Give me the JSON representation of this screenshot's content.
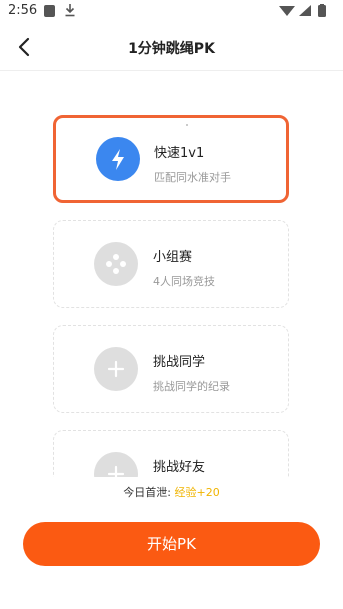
{
  "status_bar": {
    "time": "2:56",
    "icons": [
      "app-icon",
      "download-icon",
      "wifi-icon",
      "signal-icon",
      "battery-icon"
    ]
  },
  "header": {
    "back_icon": "back-arrow-icon",
    "title": "1分钟跳绳PK"
  },
  "modes": [
    {
      "title": "快速1v1",
      "subtitle": "匹配同水准对手",
      "icon": "lightning-icon",
      "selected": true,
      "icon_color": "#3b87ef"
    },
    {
      "title": "小组赛",
      "subtitle": "4人同场竞技",
      "icon": "gamepad-icon",
      "selected": false
    },
    {
      "title": "挑战同学",
      "subtitle": "挑战同学的纪录",
      "icon": "plus-icon",
      "selected": false
    },
    {
      "title": "挑战好友",
      "subtitle": "",
      "icon": "plus-icon",
      "selected": false
    }
  ],
  "footer": {
    "today_label": "今日首泄:",
    "today_reward": "经验+20",
    "start_button": "开始PK"
  },
  "colors": {
    "accent": "#fb5a12",
    "selected_border": "#f06434",
    "reward": "#f0b400"
  }
}
